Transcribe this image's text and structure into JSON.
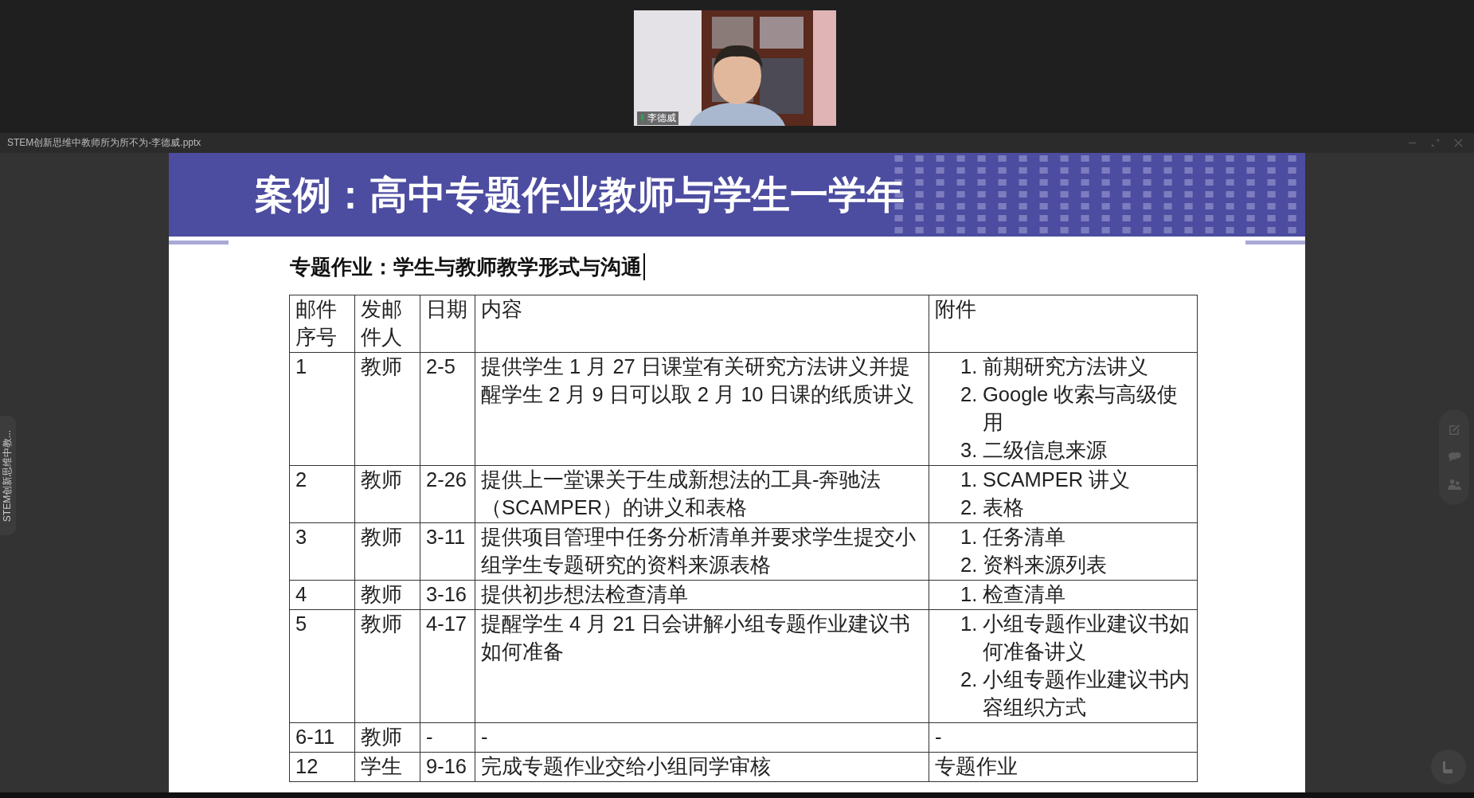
{
  "video": {
    "name": "李德威",
    "mic_on": true
  },
  "window": {
    "title": "STEM创新思维中教师所为所不为-李德威.pptx"
  },
  "side_tab": {
    "label": "STEM创新思维中教..."
  },
  "slide": {
    "title": "案例：高中专题作业教师与学生一学年",
    "subtitle": "专题作业：学生与教师教学形式与沟通",
    "table": {
      "columns": [
        "邮件序号",
        "发邮件人",
        "日期",
        "内容",
        "附件"
      ],
      "rows": [
        {
          "cells": [
            "1",
            "教师",
            "2-5",
            "提供学生 1 月 27 日课堂有关研究方法讲义并提醒学生 2 月 9 日可以取 2 月 10 日课的纸质讲义"
          ],
          "attachments": [
            {
              "number": "1.",
              "text": "前期研究方法讲义"
            },
            {
              "number": "2.",
              "text": "Google 收索与高级使用"
            },
            {
              "number": "3.",
              "text": "二级信息来源"
            }
          ]
        },
        {
          "cells": [
            "2",
            "教师",
            "2-26",
            "提供上一堂课关于生成新想法的工具-奔驰法（SCAMPER）的讲义和表格"
          ],
          "attachments": [
            {
              "number": "1.",
              "text": "SCAMPER 讲义"
            },
            {
              "number": "2.",
              "text": "表格"
            }
          ]
        },
        {
          "cells": [
            "3",
            "教师",
            "3-11",
            "提供项目管理中任务分析清单并要求学生提交小组学生专题研究的资料来源表格"
          ],
          "attachments": [
            {
              "number": "1.",
              "text": "任务清单"
            },
            {
              "number": "2.",
              "text": "资料来源列表"
            }
          ]
        },
        {
          "cells": [
            "4",
            "教师",
            "3-16",
            "提供初步想法检查清单"
          ],
          "attachments": [
            {
              "number": "1.",
              "text": "检查清单"
            }
          ]
        },
        {
          "cells": [
            "5",
            "教师",
            "4-17",
            "提醒学生 4 月 21 日会讲解小组专题作业建议书如何准备"
          ],
          "attachments": [
            {
              "number": "1.",
              "text": "小组专题作业建议书如何准备讲义"
            },
            {
              "number": "2.",
              "text": "小组专题作业建议书内容组织方式"
            }
          ]
        },
        {
          "cells": [
            "6-11",
            "教师",
            "-",
            "-"
          ],
          "attachments": [
            {
              "text": "-"
            }
          ]
        },
        {
          "cells": [
            "12",
            "学生",
            "9-16",
            "完成专题作业交给小组同学审核"
          ],
          "attachments": [
            {
              "text": "专题作业"
            }
          ]
        }
      ]
    }
  }
}
